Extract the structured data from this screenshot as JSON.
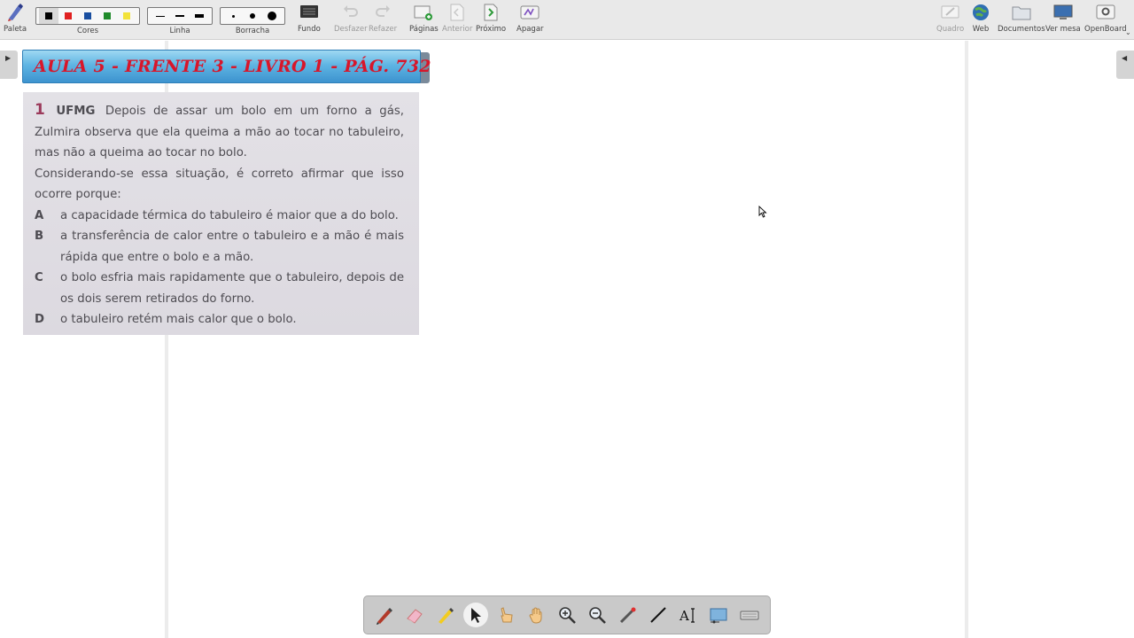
{
  "toolbar": {
    "paleta": "Paleta",
    "cores": "Cores",
    "linha": "Linha",
    "borracha": "Borracha",
    "fundo": "Fundo",
    "desfazer": "Desfazer",
    "refazer": "Refazer",
    "paginas": "Páginas",
    "anterior": "Anterior",
    "proximo": "Próximo",
    "apagar": "Apagar",
    "quadro": "Quadro",
    "web": "Web",
    "documentos": "Documentos",
    "ver_mesa": "Ver mesa",
    "openboard": "OpenBoard",
    "colors": [
      "#000000",
      "#e02020",
      "#1a4fa0",
      "#1f8a2a",
      "#f2e23a"
    ]
  },
  "banner": {
    "title": "AULA 5 - FRENTE 3 - LIVRO 1 - PÁG. 732"
  },
  "question": {
    "number": "1",
    "source": "UFMG",
    "text": "Depois de assar um bolo em um forno a gás, Zulmira observa que ela queima a mão ao tocar no tabuleiro, mas não a queima ao tocar no bolo.",
    "prompt": "Considerando-se essa situação, é correto afirmar que isso ocorre porque:",
    "options": [
      {
        "letter": "A",
        "text": "a capacidade térmica do tabuleiro é maior que a do bolo."
      },
      {
        "letter": "B",
        "text": "a transferência de calor entre o tabuleiro e a mão é mais rápida que entre o bolo e a mão."
      },
      {
        "letter": "C",
        "text": "o bolo esfria mais rapidamente que o tabuleiro, depois de os dois serem retirados do forno."
      },
      {
        "letter": "D",
        "text": "o tabuleiro retém mais calor que o bolo."
      }
    ]
  },
  "bottom_tools": [
    "pen-icon",
    "eraser-icon",
    "highlighter-icon",
    "selector-icon",
    "pointer-hand-icon",
    "hand-icon",
    "zoom-in-icon",
    "zoom-out-icon",
    "laser-icon",
    "line-icon",
    "text-icon",
    "capture-icon",
    "keyboard-icon"
  ]
}
